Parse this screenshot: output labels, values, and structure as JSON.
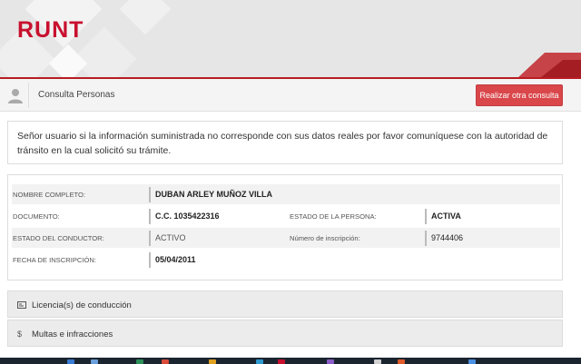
{
  "header": {
    "logo": "RUNT"
  },
  "consulta": {
    "title": "Consulta Personas",
    "button_label": "Realizar otra consulta"
  },
  "notice": {
    "text": "Señor usuario si la información suministrada no corresponde con sus datos reales por favor comuníquese con la autoridad de tránsito en la cual solicitó su trámite."
  },
  "persona": {
    "nombre_label": "NOMBRE COMPLETO:",
    "nombre": "DUBAN ARLEY MUÑOZ VILLA",
    "documento_label": "DOCUMENTO:",
    "documento": "C.C. 1035422316",
    "estado_persona_label": "ESTADO DE LA PERSONA:",
    "estado_persona": "ACTIVA",
    "estado_conductor_label": "ESTADO DEL CONDUCTOR:",
    "estado_conductor": "ACTIVO",
    "numero_inscripcion_label": "Número de inscripción:",
    "numero_inscripcion": "9744406",
    "fecha_inscripcion_label": "FECHA DE INSCRIPCIÓN:",
    "fecha_inscripcion": "05/04/2011"
  },
  "sections": {
    "licencias": {
      "icon": "id-card-icon",
      "label": "Licencia(s) de conducción"
    },
    "multas": {
      "icon": "dollar-icon",
      "label": "Multas e infracciones"
    }
  },
  "colors": {
    "brand_red": "#c8102e",
    "button_red": "#d9474b",
    "taskbar": "#1b2530"
  }
}
